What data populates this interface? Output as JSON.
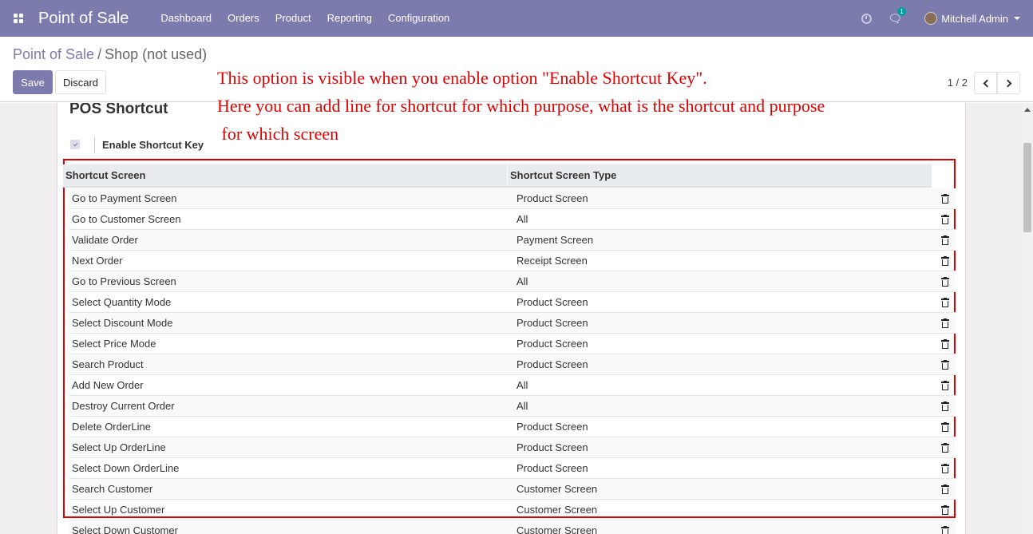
{
  "navbar": {
    "app_title": "Point of Sale",
    "menu": [
      "Dashboard",
      "Orders",
      "Product",
      "Reporting",
      "Configuration"
    ],
    "chat_badge": "1",
    "user_name": "Mitchell Admin"
  },
  "breadcrumb": {
    "parent": "Point of Sale",
    "separator": "/",
    "current": "Shop (not used)"
  },
  "buttons": {
    "save": "Save",
    "discard": "Discard"
  },
  "pager": {
    "value": "1 / 2"
  },
  "annotation": {
    "line1": "This option is visible when you enable option \"Enable Shortcut Key\".",
    "line2": "Here you can add line for shortcut for which purpose, what is the shortcut and purpose",
    "line3": " for which screen"
  },
  "form": {
    "section_title": "POS Shortcut",
    "checkbox_label": "Enable Shortcut Key",
    "checkbox_checked": true
  },
  "table": {
    "headers": [
      "Shortcut Screen",
      "Shortcut Screen Type"
    ],
    "rows": [
      [
        "Go to Payment Screen",
        "Product Screen"
      ],
      [
        "Go to Customer Screen",
        "All"
      ],
      [
        "Validate Order",
        "Payment Screen"
      ],
      [
        "Next Order",
        "Receipt Screen"
      ],
      [
        "Go to Previous Screen",
        "All"
      ],
      [
        "Select Quantity Mode",
        "Product Screen"
      ],
      [
        "Select Discount Mode",
        "Product Screen"
      ],
      [
        "Select Price Mode",
        "Product Screen"
      ],
      [
        "Search Product",
        "Product Screen"
      ],
      [
        "Add New Order",
        "All"
      ],
      [
        "Destroy Current Order",
        "All"
      ],
      [
        "Delete OrderLine",
        "Product Screen"
      ],
      [
        "Select Up OrderLine",
        "Product Screen"
      ],
      [
        "Select Down OrderLine",
        "Product Screen"
      ],
      [
        "Search Customer",
        "Customer Screen"
      ],
      [
        "Select Up Customer",
        "Customer Screen"
      ],
      [
        "Select Down Customer",
        "Customer Screen"
      ]
    ]
  },
  "colors": {
    "brand": "#7c7bad",
    "annotation": "#e00000"
  }
}
